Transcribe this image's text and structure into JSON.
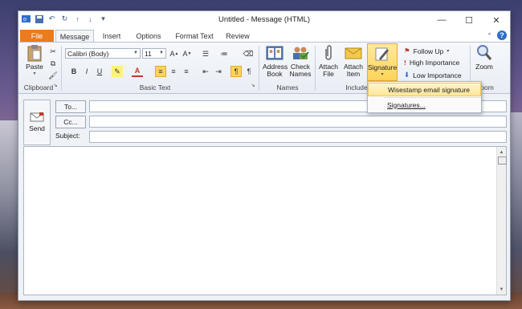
{
  "window": {
    "title": "Untitled - Message (HTML)",
    "controls": [
      "—",
      "☐",
      "✕"
    ]
  },
  "qat": [
    "save",
    "undo",
    "redo",
    "up",
    "down",
    "customize"
  ],
  "tabs": {
    "file": "File",
    "items": [
      "Message",
      "Insert",
      "Options",
      "Format Text",
      "Review"
    ],
    "active": "Message"
  },
  "ribbon": {
    "clipboard": {
      "label": "Clipboard",
      "paste": "Paste"
    },
    "basic_text": {
      "label": "Basic Text",
      "font": "Calibri (Body)",
      "size": "11",
      "bold": "B",
      "italic": "I",
      "underline": "U"
    },
    "names": {
      "label": "Names",
      "address_book": "Address Book",
      "check_names": "Check Names"
    },
    "include": {
      "label": "Include",
      "attach_file": "Attach File",
      "attach_item": "Attach Item",
      "signature": "Signature"
    },
    "tags": {
      "follow_up": "Follow Up",
      "high": "High Importance",
      "low": "Low Importance"
    },
    "zoom": {
      "label": "Zoom",
      "button": "Zoom"
    }
  },
  "compose": {
    "send": "Send",
    "to": "To...",
    "cc": "Cc...",
    "subject": "Subject:"
  },
  "signature_menu": {
    "items": [
      "Wisestamp email signature",
      "Signatures..."
    ]
  },
  "colors": {
    "file_tab": "#e87c1f",
    "signature_highlight": "#ffd45a",
    "help": "#2f6fc7"
  }
}
